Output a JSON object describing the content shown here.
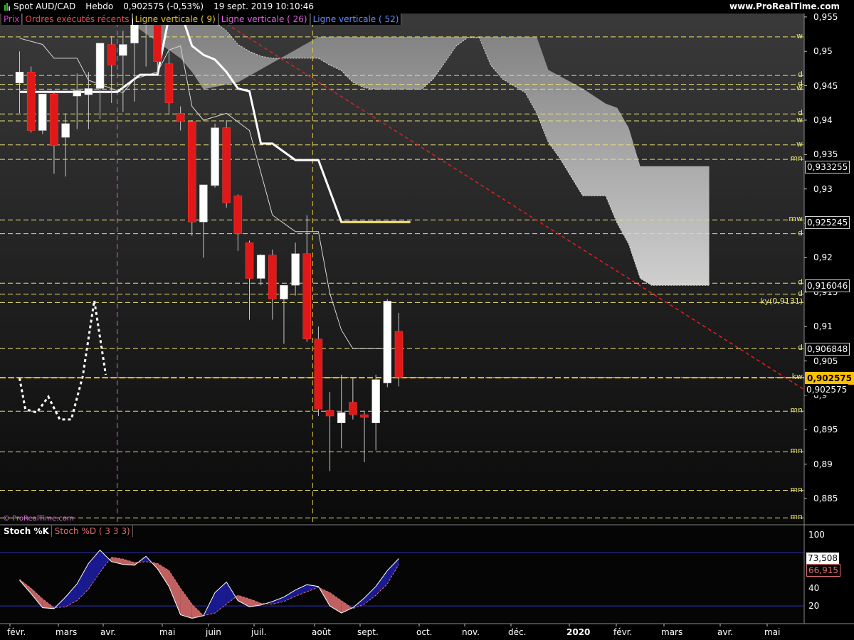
{
  "header": {
    "symbol": "Spot AUD/CAD",
    "timeframe": "Hebdo",
    "price_change": "0,902575 (-0,53%)",
    "datetime": "19 sept. 2019 10:10:46",
    "brand": "www.ProRealTime.com"
  },
  "price_panel": {
    "legend": [
      {
        "text": "Prix",
        "color": "#d040d0"
      },
      {
        "text": "Ordres exécutés récents",
        "color": "#e05050"
      },
      {
        "text": "Ligne verticale ( 9)",
        "color": "#e8c840"
      },
      {
        "text": "Ligne verticale ( 26)",
        "color": "#e060e0"
      },
      {
        "text": "Ligne verticale ( 52)",
        "color": "#6090ff"
      }
    ],
    "watermark": "© ProRealTime.com",
    "axis_labels": [
      "0,955",
      "0,95",
      "0,945",
      "0,94",
      "0,935",
      "0,93",
      "0,925",
      "0,92",
      "0,915",
      "0,91",
      "0,905",
      "0,9",
      "0,895",
      "0,89",
      "0,885"
    ],
    "value_tags": [
      {
        "text": "0,933255",
        "value": 0.933255,
        "style": "box"
      },
      {
        "text": "0,925245",
        "value": 0.925245,
        "style": "box"
      },
      {
        "text": "0,916046",
        "value": 0.916046,
        "style": "box"
      },
      {
        "text": "0,906848",
        "value": 0.906848,
        "style": "box"
      },
      {
        "text": "0,902575",
        "value": 0.902575,
        "style": "current"
      },
      {
        "text": "0,902575",
        "value": 0.902575,
        "style": "box-below"
      }
    ],
    "level_tags": [
      {
        "text": "w",
        "value": 0.9521
      },
      {
        "text": "d",
        "value": 0.9465
      },
      {
        "text": "d",
        "value": 0.9452
      },
      {
        "text": "w",
        "value": 0.9445
      },
      {
        "text": "d",
        "value": 0.9409
      },
      {
        "text": "w",
        "value": 0.9399
      },
      {
        "text": "w",
        "value": 0.9364
      },
      {
        "text": "mn",
        "value": 0.9343
      },
      {
        "text": "mw",
        "value": 0.9255
      },
      {
        "text": "d",
        "value": 0.9235
      },
      {
        "text": "d",
        "value": 0.9163
      },
      {
        "text": "d",
        "value": 0.9147
      },
      {
        "text": "ky(0,9131)",
        "value": 0.9135
      },
      {
        "text": "d",
        "value": 0.9068
      },
      {
        "text": "kw",
        "value": 0.9026
      },
      {
        "text": "mn",
        "value": 0.8977
      },
      {
        "text": "mn",
        "value": 0.8918
      },
      {
        "text": "mn",
        "value": 0.8862
      },
      {
        "text": "mn",
        "value": 0.8822
      }
    ]
  },
  "stoch_panel": {
    "legend": [
      {
        "text": "Stoch %K",
        "color": "#ffffff"
      },
      {
        "text": "Stoch %D ( 3 3 3)",
        "color": "#e07070"
      }
    ],
    "axis_labels": [
      "100",
      "40",
      "20"
    ],
    "k_value": "73,508",
    "d_value": "66,915"
  },
  "x_axis": {
    "months": [
      "févr.",
      "mars",
      "avr.",
      "mai",
      "juin",
      "juil.",
      "août",
      "sept.",
      "oct.",
      "nov.",
      "déc.",
      "2020",
      "févr.",
      "mars",
      "avr.",
      "mai"
    ]
  },
  "colors": {
    "bull": "#ffffff",
    "bear": "#e01818",
    "level_line": "#e8e070",
    "current_price": "#ffc000",
    "trendline": "#e02020",
    "kijun": "#ffffff",
    "cloud": "#a0a0a0",
    "stoch_bull_fill": "#1a1a90",
    "stoch_bear_fill": "#c06060"
  },
  "chart_data": [
    {
      "type": "candlestick",
      "title": "Spot AUD/CAD Hebdo",
      "ylim": [
        0.8815,
        0.9555
      ],
      "x_unit": "weeks (index 0 = first visible week, ≈ late Jan 2019)",
      "candles": [
        {
          "o": 0.9454,
          "h": 0.95,
          "l": 0.941,
          "c": 0.947
        },
        {
          "o": 0.947,
          "h": 0.9478,
          "l": 0.9382,
          "c": 0.9385
        },
        {
          "o": 0.9385,
          "h": 0.942,
          "l": 0.938,
          "c": 0.9438
        },
        {
          "o": 0.9438,
          "h": 0.9442,
          "l": 0.9322,
          "c": 0.9363
        },
        {
          "o": 0.9375,
          "h": 0.941,
          "l": 0.9318,
          "c": 0.9395
        },
        {
          "o": 0.9435,
          "h": 0.9468,
          "l": 0.9387,
          "c": 0.9443
        },
        {
          "o": 0.9437,
          "h": 0.947,
          "l": 0.9387,
          "c": 0.9446
        },
        {
          "o": 0.9446,
          "h": 0.9478,
          "l": 0.9402,
          "c": 0.9512
        },
        {
          "o": 0.951,
          "h": 0.9522,
          "l": 0.9425,
          "c": 0.948
        },
        {
          "o": 0.9494,
          "h": 0.953,
          "l": 0.9412,
          "c": 0.951
        },
        {
          "o": 0.9512,
          "h": 0.956,
          "l": 0.9427,
          "c": 0.9548
        },
        {
          "o": 0.956,
          "h": 0.9565,
          "l": 0.9478,
          "c": 0.9542
        },
        {
          "o": 0.9542,
          "h": 0.9555,
          "l": 0.9468,
          "c": 0.9485
        },
        {
          "o": 0.9482,
          "h": 0.95,
          "l": 0.9408,
          "c": 0.9425
        },
        {
          "o": 0.941,
          "h": 0.942,
          "l": 0.9385,
          "c": 0.9398
        },
        {
          "o": 0.9398,
          "h": 0.94,
          "l": 0.9232,
          "c": 0.9252
        },
        {
          "o": 0.9252,
          "h": 0.9305,
          "l": 0.92,
          "c": 0.9306
        },
        {
          "o": 0.9305,
          "h": 0.9395,
          "l": 0.9302,
          "c": 0.9389
        },
        {
          "o": 0.9389,
          "h": 0.94,
          "l": 0.9273,
          "c": 0.928
        },
        {
          "o": 0.929,
          "h": 0.9292,
          "l": 0.921,
          "c": 0.9235
        },
        {
          "o": 0.9222,
          "h": 0.9225,
          "l": 0.911,
          "c": 0.917
        },
        {
          "o": 0.917,
          "h": 0.9205,
          "l": 0.916,
          "c": 0.9204
        },
        {
          "o": 0.9204,
          "h": 0.9212,
          "l": 0.911,
          "c": 0.914
        },
        {
          "o": 0.914,
          "h": 0.916,
          "l": 0.9075,
          "c": 0.916
        },
        {
          "o": 0.916,
          "h": 0.9222,
          "l": 0.9145,
          "c": 0.9206
        },
        {
          "o": 0.9206,
          "h": 0.9262,
          "l": 0.9078,
          "c": 0.9082
        },
        {
          "o": 0.9082,
          "h": 0.91,
          "l": 0.897,
          "c": 0.898
        },
        {
          "o": 0.8978,
          "h": 0.9005,
          "l": 0.889,
          "c": 0.897
        },
        {
          "o": 0.896,
          "h": 0.903,
          "l": 0.8923,
          "c": 0.8975
        },
        {
          "o": 0.899,
          "h": 0.9025,
          "l": 0.8965,
          "c": 0.8972
        },
        {
          "o": 0.8972,
          "h": 0.8976,
          "l": 0.8903,
          "c": 0.8968
        },
        {
          "o": 0.896,
          "h": 0.903,
          "l": 0.892,
          "c": 0.9023
        },
        {
          "o": 0.9018,
          "h": 0.914,
          "l": 0.9012,
          "c": 0.9137
        },
        {
          "o": 0.9093,
          "h": 0.912,
          "l": 0.9013,
          "c": 0.9026
        }
      ],
      "kijun": [
        {
          "x": 0,
          "y": 0.9441
        },
        {
          "x": 8.5,
          "y": 0.9441
        },
        {
          "x": 10.5,
          "y": 0.9466
        },
        {
          "x": 12,
          "y": 0.9466
        },
        {
          "x": 13,
          "y": 0.955
        },
        {
          "x": 14,
          "y": 0.9558
        },
        {
          "x": 15,
          "y": 0.9508
        },
        {
          "x": 16,
          "y": 0.9495
        },
        {
          "x": 17,
          "y": 0.9488
        },
        {
          "x": 18,
          "y": 0.947
        },
        {
          "x": 19,
          "y": 0.9446
        },
        {
          "x": 20,
          "y": 0.9442
        },
        {
          "x": 21,
          "y": 0.9366
        },
        {
          "x": 22,
          "y": 0.9366
        },
        {
          "x": 24,
          "y": 0.9342
        },
        {
          "x": 26,
          "y": 0.9342
        },
        {
          "x": 28,
          "y": 0.9252
        },
        {
          "x": 34,
          "y": 0.9252
        }
      ],
      "chikou": [
        {
          "x": 0,
          "y": 0.9519
        },
        {
          "x": 2,
          "y": 0.951
        },
        {
          "x": 3,
          "y": 0.949
        },
        {
          "x": 5,
          "y": 0.949
        },
        {
          "x": 6,
          "y": 0.9458
        },
        {
          "x": 9,
          "y": 0.944
        },
        {
          "x": 10,
          "y": 0.946
        },
        {
          "x": 12,
          "y": 0.947
        },
        {
          "x": 13,
          "y": 0.9502
        },
        {
          "x": 14,
          "y": 0.9508
        },
        {
          "x": 15,
          "y": 0.942
        },
        {
          "x": 16,
          "y": 0.94
        },
        {
          "x": 18,
          "y": 0.941
        },
        {
          "x": 20,
          "y": 0.9385
        },
        {
          "x": 22,
          "y": 0.9262
        },
        {
          "x": 24,
          "y": 0.9238
        },
        {
          "x": 26,
          "y": 0.9238
        },
        {
          "x": 27,
          "y": 0.9148
        },
        {
          "x": 28,
          "y": 0.9095
        },
        {
          "x": 29,
          "y": 0.9068
        },
        {
          "x": 32,
          "y": 0.9068
        }
      ],
      "tenkan_dotted": [
        {
          "x": 0,
          "y": 0.9025
        },
        {
          "x": 0.5,
          "y": 0.898
        },
        {
          "x": 1.5,
          "y": 0.8975
        },
        {
          "x": 2.5,
          "y": 0.8998
        },
        {
          "x": 3.5,
          "y": 0.8965
        },
        {
          "x": 4.5,
          "y": 0.8965
        },
        {
          "x": 5.5,
          "y": 0.9028
        },
        {
          "x": 6.5,
          "y": 0.9138
        },
        {
          "x": 7.5,
          "y": 0.903
        }
      ],
      "cloud_upper": [
        {
          "x": 8.5,
          "y": 0.9555
        },
        {
          "x": 16,
          "y": 0.9555
        },
        {
          "x": 18,
          "y": 0.953
        },
        {
          "x": 19,
          "y": 0.951
        },
        {
          "x": 20,
          "y": 0.95
        },
        {
          "x": 21,
          "y": 0.9493
        },
        {
          "x": 22,
          "y": 0.949
        },
        {
          "x": 26,
          "y": 0.949
        },
        {
          "x": 27,
          "y": 0.948
        },
        {
          "x": 28,
          "y": 0.9472
        },
        {
          "x": 29,
          "y": 0.9455
        },
        {
          "x": 30,
          "y": 0.9447
        },
        {
          "x": 31,
          "y": 0.9445
        },
        {
          "x": 35,
          "y": 0.9445
        },
        {
          "x": 36,
          "y": 0.946
        },
        {
          "x": 38,
          "y": 0.9508
        },
        {
          "x": 39,
          "y": 0.952
        },
        {
          "x": 40,
          "y": 0.952
        },
        {
          "x": 41,
          "y": 0.948
        },
        {
          "x": 42,
          "y": 0.946
        },
        {
          "x": 44,
          "y": 0.944
        },
        {
          "x": 45,
          "y": 0.941
        },
        {
          "x": 46,
          "y": 0.9368
        },
        {
          "x": 47,
          "y": 0.9345
        },
        {
          "x": 49,
          "y": 0.929
        },
        {
          "x": 51,
          "y": 0.929
        },
        {
          "x": 52,
          "y": 0.925
        },
        {
          "x": 53,
          "y": 0.922
        },
        {
          "x": 54,
          "y": 0.917
        },
        {
          "x": 55,
          "y": 0.916
        },
        {
          "x": 60,
          "y": 0.916
        }
      ],
      "cloud_lower": [
        {
          "x": 8.5,
          "y": 0.9555
        },
        {
          "x": 14,
          "y": 0.949
        },
        {
          "x": 15,
          "y": 0.947
        },
        {
          "x": 16,
          "y": 0.9445
        },
        {
          "x": 19,
          "y": 0.9455
        },
        {
          "x": 26,
          "y": 0.9521
        },
        {
          "x": 37,
          "y": 0.9521
        },
        {
          "x": 45,
          "y": 0.9521
        },
        {
          "x": 46,
          "y": 0.9473
        },
        {
          "x": 47,
          "y": 0.9464
        },
        {
          "x": 49,
          "y": 0.9446
        },
        {
          "x": 51,
          "y": 0.9424
        },
        {
          "x": 52,
          "y": 0.9418
        },
        {
          "x": 53,
          "y": 0.9389
        },
        {
          "x": 54,
          "y": 0.9333
        },
        {
          "x": 60,
          "y": 0.9333
        }
      ],
      "trendline": [
        {
          "x": 18,
          "y": 0.954
        },
        {
          "x": 70,
          "y": 0.899
        }
      ],
      "vertical_lines": [
        {
          "x": 8.5,
          "label": "Ligne verticale ( 26)"
        },
        {
          "x": 25.5,
          "label": "Ligne verticale ( 9)"
        }
      ]
    },
    {
      "type": "line",
      "title": "Stoch %K / Stoch %D ( 3 3 3)",
      "ylim": [
        0,
        110
      ],
      "reference_lines": [
        80,
        20
      ],
      "series": [
        {
          "name": "Stoch %K",
          "values": [
            49,
            34,
            18,
            17,
            30,
            45,
            68,
            83,
            70,
            67,
            66,
            76,
            62,
            42,
            10,
            6,
            9,
            35,
            47,
            26,
            19,
            21,
            25,
            30,
            38,
            44,
            42,
            20,
            12,
            18,
            29,
            42,
            60,
            73.5
          ]
        },
        {
          "name": "Stoch %D ( 3 3 3)",
          "values": [
            50,
            40,
            28,
            18,
            19,
            26,
            39,
            58,
            75,
            73,
            69,
            70,
            68,
            60,
            40,
            22,
            9,
            12,
            22,
            32,
            28,
            23,
            22,
            25,
            31,
            36,
            41,
            35,
            26,
            17,
            22,
            32,
            45,
            66.9
          ]
        }
      ]
    }
  ]
}
